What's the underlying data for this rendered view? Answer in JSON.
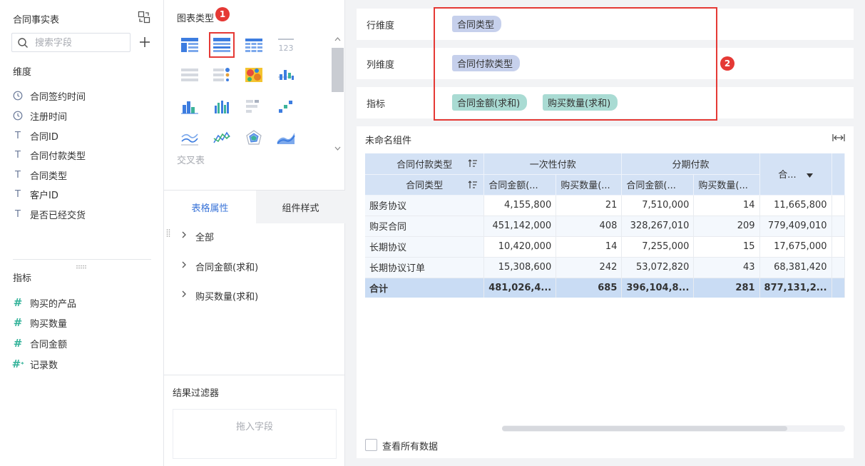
{
  "left_panel": {
    "dataset_title": "合同事实表",
    "search_placeholder": "搜索字段",
    "dimension_label": "维度",
    "dimensions": [
      {
        "icon": "clock-icon",
        "name": "合同签约时间"
      },
      {
        "icon": "clock-icon",
        "name": "注册时间"
      },
      {
        "icon": "text-icon",
        "name": "合同ID"
      },
      {
        "icon": "text-icon",
        "name": "合同付款类型"
      },
      {
        "icon": "text-icon",
        "name": "合同类型"
      },
      {
        "icon": "text-icon",
        "name": "客户ID"
      },
      {
        "icon": "text-icon",
        "name": "是否已经交货"
      }
    ],
    "measure_label": "指标",
    "measures": [
      {
        "icon": "hash-icon",
        "name": "购买的产品"
      },
      {
        "icon": "hash-icon",
        "name": "购买数量"
      },
      {
        "icon": "hash-icon",
        "name": "合同金额"
      },
      {
        "icon": "hash-star-icon",
        "name": "记录数"
      }
    ]
  },
  "chart_panel": {
    "title": "图表类型",
    "badge_1": "1",
    "selected_type": "交叉表",
    "hover_label": "交叉表",
    "tabs": [
      {
        "label": "表格属性",
        "active": true
      },
      {
        "label": "组件样式",
        "active": false
      }
    ],
    "properties": [
      "全部",
      "合同金额(求和)",
      "购买数量(求和)"
    ],
    "result_filter": {
      "title": "结果过滤器",
      "drop_hint": "拖入字段"
    }
  },
  "shelves": {
    "badge_2": "2",
    "row": {
      "label": "行维度",
      "pills": [
        "合同类型"
      ]
    },
    "column": {
      "label": "列维度",
      "pills": [
        "合同付款类型"
      ]
    },
    "measure": {
      "label": "指标",
      "pills": [
        "合同金额(求和)",
        "购买数量(求和)"
      ]
    }
  },
  "component": {
    "title": "未命名组件",
    "table": {
      "col_dim_header": "合同付款类型",
      "row_dim_header": "合同类型",
      "col_groups": [
        "一次性付款",
        "分期付款",
        "合..."
      ],
      "sub_headers": [
        "合同金额(...",
        "购买数量(...",
        "合同金额(...",
        "购买数量(..."
      ],
      "rows": [
        {
          "name": "服务协议",
          "values": [
            "4,155,800",
            "21",
            "7,510,000",
            "14",
            "11,665,800"
          ]
        },
        {
          "name": "购买合同",
          "values": [
            "451,142,000",
            "408",
            "328,267,010",
            "209",
            "779,409,010"
          ]
        },
        {
          "name": "长期协议",
          "values": [
            "10,420,000",
            "14",
            "7,255,000",
            "15",
            "17,675,000"
          ]
        },
        {
          "name": "长期协议订单",
          "values": [
            "15,308,600",
            "242",
            "53,072,820",
            "43",
            "68,381,420"
          ]
        }
      ],
      "total": {
        "name": "合计",
        "values": [
          "481,026,4...",
          "685",
          "396,104,8...",
          "281",
          "877,131,2..."
        ]
      }
    },
    "show_all_label": "查看所有数据"
  },
  "colors": {
    "accent": "#3a74d8",
    "highlight_red": "#e53935",
    "dim_pill": "#c6d0ec",
    "measure_pill": "#a9dbd3",
    "table_header": "#d4e2f5"
  }
}
